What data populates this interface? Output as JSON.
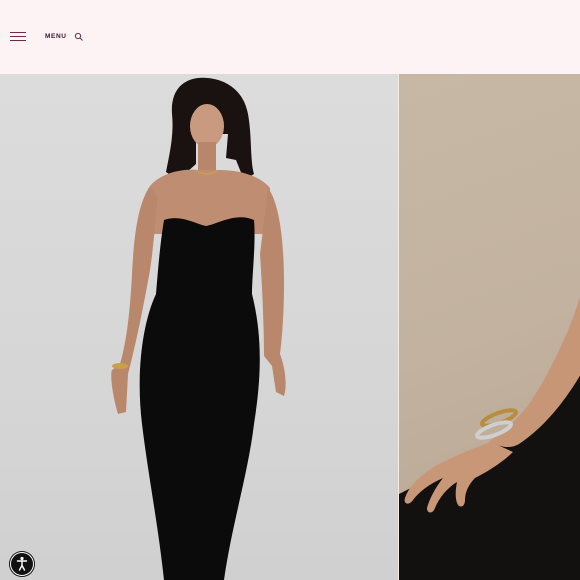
{
  "header": {
    "menu_label": "MENU",
    "hamburger_icon": "hamburger-menu-icon",
    "search_icon": "search-icon",
    "background_color": "#fdf3f4",
    "accent_color": "#6b2b4a"
  },
  "gallery": {
    "slides": [
      {
        "subject": "model-black-strapless-dress"
      },
      {
        "subject": "model-wearing-bangles"
      }
    ]
  },
  "accessibility": {
    "icon": "accessibility-icon"
  }
}
